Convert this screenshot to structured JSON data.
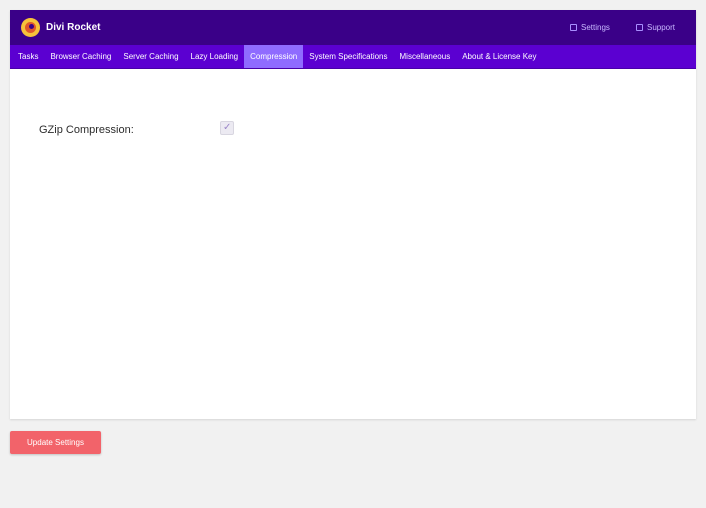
{
  "header": {
    "brand": "Divi Rocket",
    "settings_label": "Settings",
    "support_label": "Support"
  },
  "tabs": [
    {
      "label": "Tasks"
    },
    {
      "label": "Browser Caching"
    },
    {
      "label": "Server Caching"
    },
    {
      "label": "Lazy Loading"
    },
    {
      "label": "Compression",
      "active": true
    },
    {
      "label": "System Specifications"
    },
    {
      "label": "Miscellaneous"
    },
    {
      "label": "About & License Key"
    }
  ],
  "content": {
    "gzip_label": "GZip Compression:",
    "gzip_checked": true
  },
  "footer": {
    "update_label": "Update Settings"
  },
  "colors": {
    "header_bg": "#3a0088",
    "tabs_bg": "#5b00d1",
    "active_tab_bg": "#8f6bff",
    "button_bg": "#f2636a"
  },
  "icons": {
    "logo": "rocket-logo-icon",
    "settings": "settings-icon",
    "support": "support-icon",
    "check": "checkmark-icon"
  }
}
